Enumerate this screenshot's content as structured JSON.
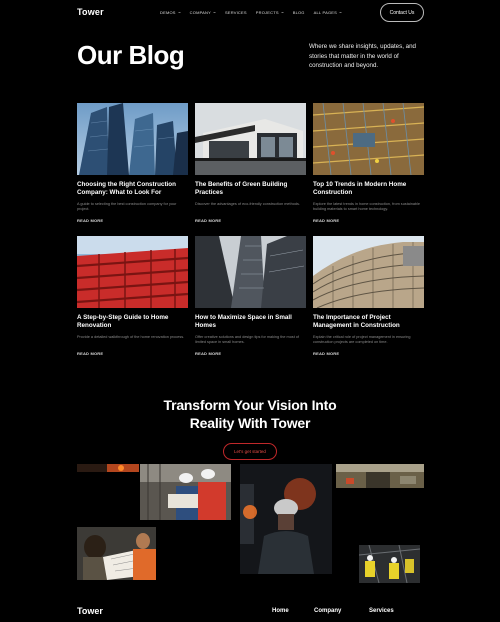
{
  "nav": {
    "brand": "Tower",
    "items": [
      {
        "label": "DEMOS",
        "has_dropdown": true
      },
      {
        "label": "COMPANY",
        "has_dropdown": true
      },
      {
        "label": "SERVICES",
        "has_dropdown": false
      },
      {
        "label": "PROJECTS",
        "has_dropdown": true
      },
      {
        "label": "BLOG",
        "has_dropdown": false
      },
      {
        "label": "ALL PAGES",
        "has_dropdown": true
      }
    ],
    "contact_label": "Contact Us"
  },
  "hero": {
    "title": "Our Blog",
    "description": "Where we share insights, updates, and stories that matter in the world of construction and beyond."
  },
  "posts": [
    {
      "title": "Choosing the Right Construction Company: What to Look For",
      "excerpt": "A guide to selecting the best construction company for your project.",
      "read_more": "READ MORE",
      "image": "glass-skyscrapers"
    },
    {
      "title": "The Benefits of Green Building Practices",
      "excerpt": "Discover the advantages of eco-friendly construction methods.",
      "read_more": "READ MORE",
      "image": "modern-house"
    },
    {
      "title": "Top 10 Trends in Modern Home Construction",
      "excerpt": "Explore the latest trends in home construction, from sustainable building materials to smart home technology.",
      "read_more": "READ MORE",
      "image": "construction-site-aerial"
    },
    {
      "title": "A Step-by-Step Guide to Home Renovation",
      "excerpt": "Provide a detailed walkthrough of the home renovation process.",
      "read_more": "READ MORE",
      "image": "red-facade"
    },
    {
      "title": "How to Maximize Space in Small Homes",
      "excerpt": "Offer creative solutions and design tips for making the most of limited space in small homes.",
      "read_more": "READ MORE",
      "image": "tower-lookup"
    },
    {
      "title": "The Importance of Project Management in Construction",
      "excerpt": "Explain the critical role of project management in ensuring construction projects are completed on time.",
      "read_more": "READ MORE",
      "image": "curved-building"
    }
  ],
  "cta": {
    "title_line1": "Transform Your Vision Into",
    "title_line2": "Reality With Tower",
    "button_label": "Let's get started"
  },
  "gallery": [
    "orange-sparks",
    "engineers-reviewing-plans",
    "welding-worker",
    "site-overview",
    "architects-at-desk",
    "workers-yellow-vests"
  ],
  "footer": {
    "brand": "Tower",
    "columns": [
      "Home",
      "Company",
      "Services"
    ]
  },
  "colors": {
    "background": "#000000",
    "accent": "#c0282a",
    "text": "#ffffff",
    "muted": "#8b8b8b"
  }
}
